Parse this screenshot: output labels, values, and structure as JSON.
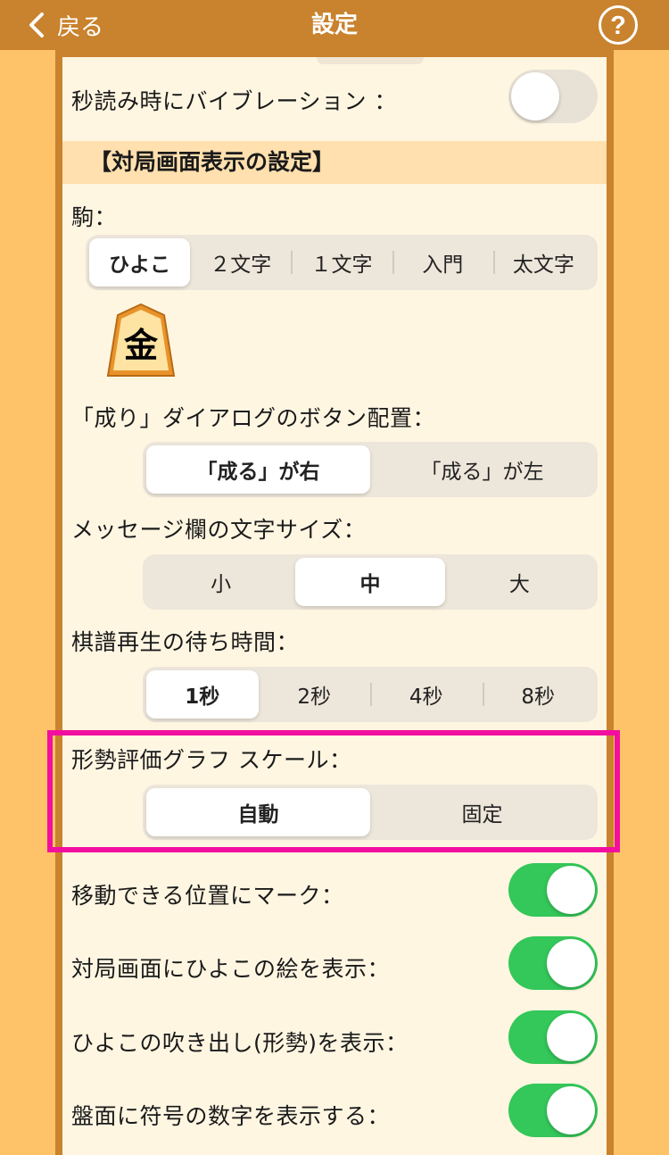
{
  "nav": {
    "back_label": "戻る",
    "title": "設定",
    "help_symbol": "?"
  },
  "vibration": {
    "label": "秒読み時にバイブレーション ：",
    "on": false
  },
  "section": {
    "title": "【対局画面表示の設定】"
  },
  "piece": {
    "label": "駒：",
    "options": [
      "ひよこ",
      "２文字",
      "１文字",
      "入門",
      "太文字"
    ],
    "selected": "ひよこ",
    "sample_char": "金"
  },
  "promotion_dialog": {
    "label": "「成り」ダイアログのボタン配置：",
    "options": [
      "「成る」が右",
      "「成る」が左"
    ],
    "selected": "「成る」が右"
  },
  "message_size": {
    "label": "メッセージ欄の文字サイズ：",
    "options": [
      "小",
      "中",
      "大"
    ],
    "selected": "中"
  },
  "replay_wait": {
    "label": "棋譜再生の待ち時間：",
    "options": [
      "1秒",
      "2秒",
      "4秒",
      "8秒"
    ],
    "selected": "1秒"
  },
  "eval_graph": {
    "label": "形勢評価グラフ スケール：",
    "options": [
      "自動",
      "固定"
    ],
    "selected": "自動"
  },
  "toggles": [
    {
      "label": "移動できる位置にマーク：",
      "on": true
    },
    {
      "label": "対局画面にひよこの絵を表示：",
      "on": true
    },
    {
      "label": "ひよこの吹き出し(形勢)を表示：",
      "on": true
    },
    {
      "label": "盤面に符号の数字を表示する：",
      "on": true
    }
  ],
  "colors": {
    "nav_bg": "#C9822D",
    "page_bg": "#FEC368",
    "panel_bg": "#FFF6E2",
    "toggle_on": "#34C759",
    "highlight": "#F20FA0"
  }
}
